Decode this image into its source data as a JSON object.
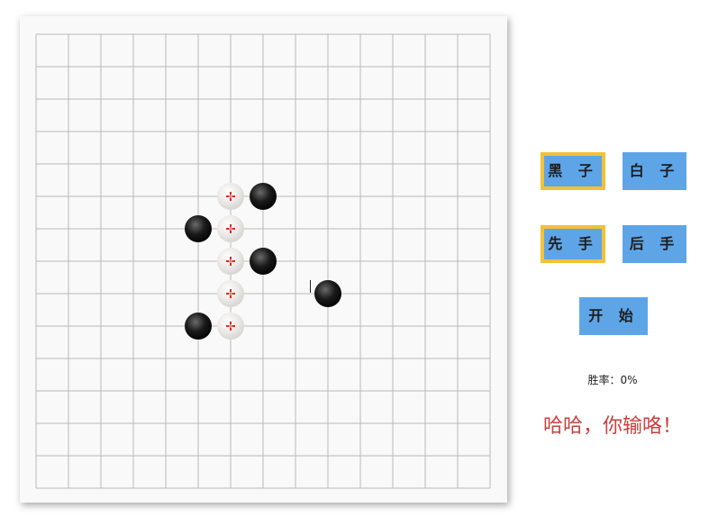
{
  "board": {
    "size": 15,
    "colors": {
      "grid_line": "#b9b9b9",
      "board_bg": "#f9f9f9",
      "black_stone": "#1a1a1a",
      "white_stone": "#d8d6d3",
      "win_marker": "#d92a1f"
    },
    "black_stones": [
      {
        "col": 7,
        "row": 5
      },
      {
        "col": 5,
        "row": 6
      },
      {
        "col": 7,
        "row": 7
      },
      {
        "col": 9,
        "row": 8
      },
      {
        "col": 5,
        "row": 9
      }
    ],
    "white_stones": [
      {
        "col": 6,
        "row": 5,
        "winning": true
      },
      {
        "col": 6,
        "row": 6,
        "winning": true
      },
      {
        "col": 6,
        "row": 7,
        "winning": true
      },
      {
        "col": 6,
        "row": 8,
        "winning": true
      },
      {
        "col": 6,
        "row": 9,
        "winning": true
      }
    ],
    "win_marker_icon": "crosshair-icon"
  },
  "controls": {
    "black_label": "黑 子",
    "white_label": "白 子",
    "first_label": "先 手",
    "second_label": "后 手",
    "start_label": "开 始",
    "selected_stone": "black",
    "selected_order": "first",
    "accent_color": "#5ea5e8",
    "selected_border_color": "#f2c137"
  },
  "stats": {
    "win_rate_text": "胜率：0%"
  },
  "message": {
    "result_text": "哈哈，你输咯！"
  }
}
